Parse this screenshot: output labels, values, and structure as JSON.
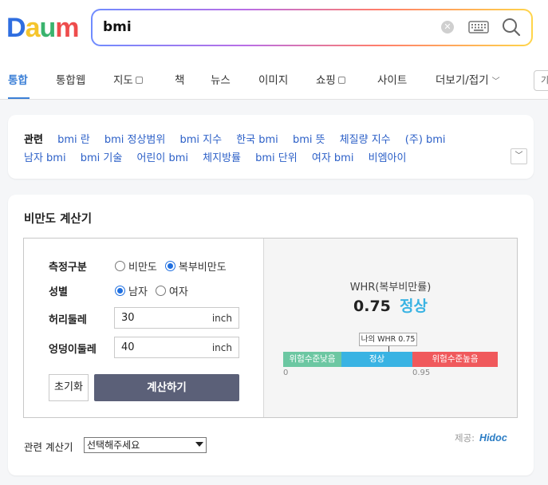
{
  "header": {
    "logo_text": "Daum",
    "search": {
      "value": "bmi",
      "clear_icon": "clear-icon",
      "keyboard_icon": "keyboard-icon",
      "search_icon": "search-icon"
    }
  },
  "tabs": [
    {
      "label": "통합"
    },
    {
      "label": "통합웹"
    },
    {
      "label": "지도"
    },
    {
      "label": "책"
    },
    {
      "label": "뉴스"
    },
    {
      "label": "이미지"
    },
    {
      "label": "쇼핑"
    },
    {
      "label": "사이트"
    },
    {
      "label": "더보기/접기"
    },
    {
      "label": "기"
    }
  ],
  "related": {
    "label": "관련",
    "row1": [
      "bmi 란",
      "bmi 정상범위",
      "bmi 지수",
      "한국 bmi",
      "bmi 뜻",
      "체질량 지수",
      "(주) bmi"
    ],
    "row2": [
      "남자 bmi",
      "bmi 기술",
      "어린이 bmi",
      "체지방률",
      "bmi 단위",
      "여자 bmi",
      "비엠아이"
    ]
  },
  "calculator": {
    "title": "비만도 계산기",
    "measure_label": "측정구분",
    "measure_options": [
      "비만도",
      "복부비만도"
    ],
    "measure_selected": "복부비만도",
    "gender_label": "성별",
    "gender_options": [
      "남자",
      "여자"
    ],
    "gender_selected": "남자",
    "waist_label": "허리둘레",
    "waist_value": "30",
    "waist_unit": "inch",
    "hip_label": "엉덩이둘레",
    "hip_value": "40",
    "hip_unit": "inch",
    "reset_label": "초기화",
    "calc_label": "계산하기",
    "result": {
      "label": "WHR(복부비만률)",
      "value": "0.75",
      "status": "정상",
      "marker_label": "나의 WHR 0.75",
      "segments": [
        "위험수준낮음",
        "정상",
        "위험수준높음"
      ],
      "tick_start": "0",
      "tick_end": "0.95",
      "marker_value": 0.75,
      "colors": {
        "low": "#6cc7a2",
        "normal": "#39b3e3",
        "high": "#f0595c",
        "status": "#39b3e3"
      }
    },
    "related_calc_label": "관련 계산기",
    "related_calc_select": "선택해주세요",
    "provider_label": "제공:",
    "provider_brand": "Hidoc"
  }
}
